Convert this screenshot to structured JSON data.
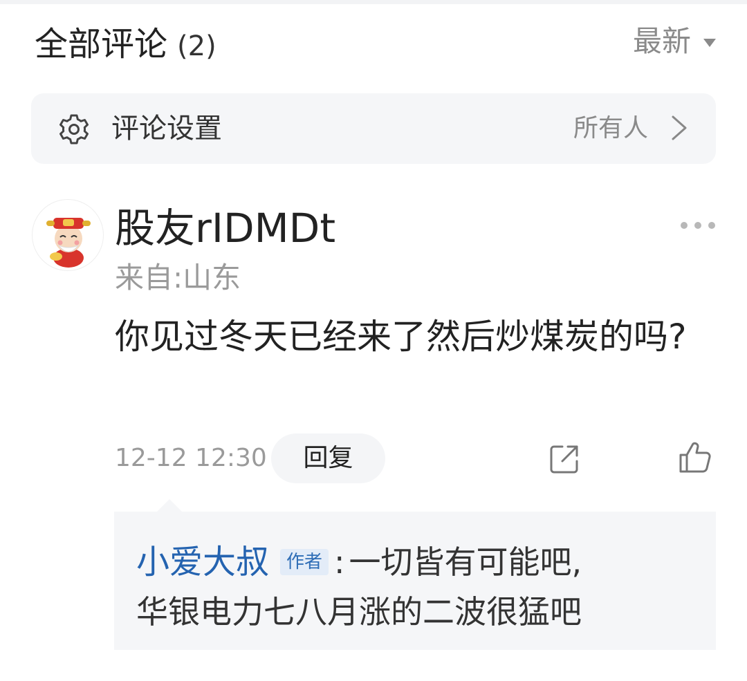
{
  "header": {
    "title": "全部评论",
    "count": "(2)",
    "sort_label": "最新"
  },
  "settings": {
    "label": "评论设置",
    "value": "所有人"
  },
  "comment": {
    "username": "股友rIDMDt",
    "location": "来自:山东",
    "text": "你见过冬天已经来了然后炒煤炭的吗?",
    "timestamp": "12-12 12:30",
    "reply_label": "回复"
  },
  "reply": {
    "author": "小爱大叔",
    "badge": "作者",
    "separator": ":",
    "text_line1": "一切皆有可能吧,",
    "text_line2": "华银电力七八月涨的二波很猛吧"
  },
  "icons": {
    "gear": "gear-icon",
    "chevron": "chevron-right-icon",
    "more": "more-dots-icon",
    "share": "share-icon",
    "like": "thumbs-up-icon"
  },
  "colors": {
    "accent_blue": "#2463b0",
    "muted_gray": "#9a9a9a",
    "panel_bg": "#f5f6f8"
  }
}
